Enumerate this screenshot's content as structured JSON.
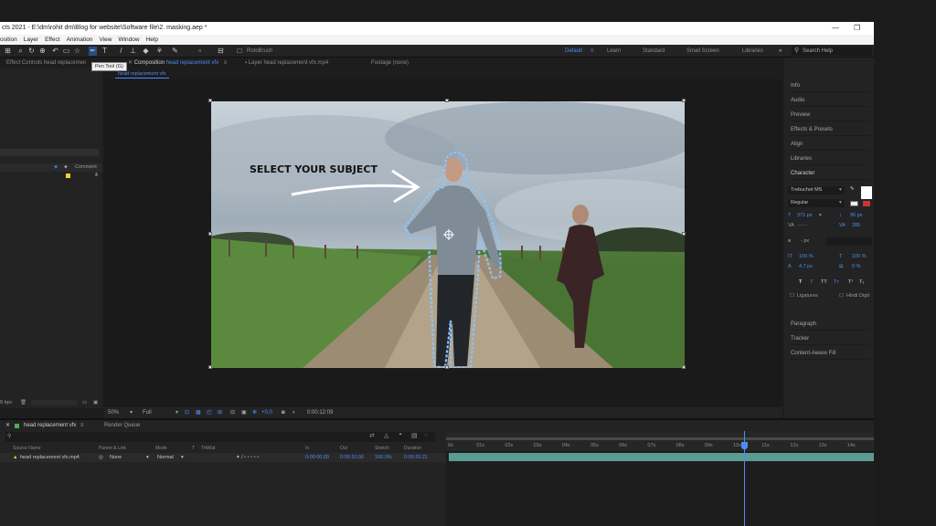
{
  "title": {
    "text": "cts 2021 - E:\\dm\\rohit dm\\Blog for website\\Software file\\2. masking.aep *",
    "minimize": "—",
    "maximize": "❐"
  },
  "menu": [
    "osition",
    "Layer",
    "Effect",
    "Animation",
    "View",
    "Window",
    "Help"
  ],
  "toolbar": {
    "rotobrush": "RotoBrush",
    "tooltip": "Pen Tool (G)"
  },
  "workspaces": [
    "Default",
    "Learn",
    "Standard",
    "Small Screen",
    "Libraries"
  ],
  "search_help": "Search Help",
  "tabs": {
    "effect_controls": "Effect Controls head replacemen",
    "composition_prefix": "Composition",
    "composition_name": "head replacement vfx",
    "layer": "Layer  head replacement vfx.mp4",
    "footage": "Footage (none)",
    "comp_subtab": "head replacement vfx"
  },
  "left_panel": {
    "header": "Comment",
    "footer": "8 bpc"
  },
  "viewer": {
    "overlay_text": "SELECT YOUR SUBJECT",
    "zoom": "50%",
    "resolution": "Full",
    "exposure": "+0.0",
    "timecode": "0:00:12:09"
  },
  "right_panel": {
    "items": [
      "Info",
      "Audio",
      "Preview",
      "Effects & Presets",
      "Align",
      "Libraries",
      "Character"
    ],
    "font_family": "Trebuchet MS",
    "font_style": "Regular",
    "font_size": "371 px",
    "leading": "95 px",
    "tracking": "285",
    "stroke_unit": "- px",
    "vscale": "100 %",
    "hscale": "100 %",
    "baseline": "4.7 px",
    "tsume": "0 %",
    "style_buttons": [
      "T",
      "T",
      "TT",
      "Tт",
      "T¹",
      "T₁"
    ],
    "ligatures": "Ligatures",
    "hindi_digits": "Hindi Digit",
    "bottom_items": [
      "Paragraph",
      "Tracker",
      "Content-Aware Fill"
    ]
  },
  "timeline": {
    "tab_name": "head replacement vfx",
    "render_queue": "Render Queue",
    "columns": [
      "Source Name",
      "Parent & Link",
      "Mode",
      "T",
      "TrkMat",
      "In",
      "Out",
      "Stretch",
      "Duration"
    ],
    "layer": {
      "name": "head replacement vfx.mp4",
      "parent": "None",
      "mode": "Normal",
      "in": "0:00:00:00",
      "out": "0:00:10:00",
      "stretch": "100.0%",
      "duration": "0:00:20:21"
    },
    "ruler_labels": [
      "0s",
      "01s",
      "02s",
      "03s",
      "04s",
      "05s",
      "06s",
      "07s",
      "08s",
      "09s",
      "10s",
      "11s",
      "12s",
      "13s",
      "14s"
    ]
  },
  "colors": {
    "accent": "#4c8df6",
    "layer_bar": "#5a9b93",
    "mask_path": "#8cc4ff",
    "label_yellow": "#e8d53a"
  }
}
